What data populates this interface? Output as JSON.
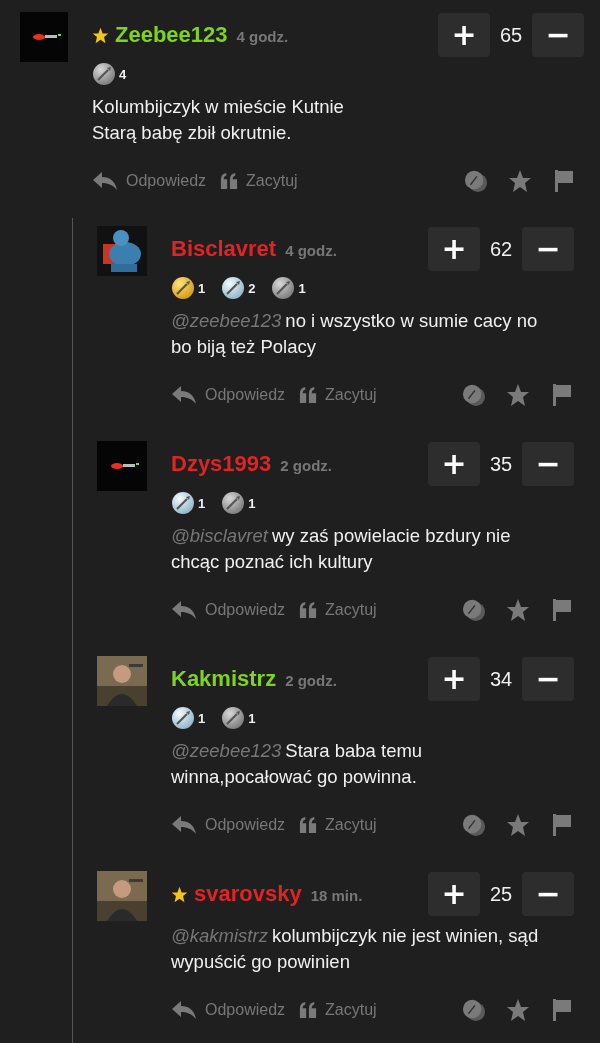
{
  "comment": {
    "author": "Zeebee123",
    "color": "#7ed321",
    "starred": true,
    "time": "4 godz.",
    "score": "65",
    "plus": "+",
    "minus": "−",
    "badges": [
      {
        "kind": "stone",
        "count": "4"
      }
    ],
    "lines": [
      "Kolumbijczyk w mieście Kutnie",
      "Starą babę zbił okrutnie."
    ],
    "reply": "Odpowiedz",
    "quote": "Zacytuj"
  },
  "replies": [
    {
      "author": "Bisclavret",
      "color": "#e02424",
      "starred": false,
      "time": "4 godz.",
      "score": "62",
      "plus": "+",
      "minus": "−",
      "badges": [
        {
          "kind": "gold",
          "count": "1"
        },
        {
          "kind": "silver",
          "count": "2"
        },
        {
          "kind": "stone",
          "count": "1"
        }
      ],
      "mention": "@zeebee123",
      "lines": [
        "no i wszystko w sumie cacy no",
        "bo biją też Polacy"
      ],
      "reply": "Odpowiedz",
      "quote": "Zacytuj"
    },
    {
      "author": "Dzys1993",
      "color": "#e02424",
      "starred": false,
      "time": "2 godz.",
      "score": "35",
      "plus": "+",
      "minus": "−",
      "badges": [
        {
          "kind": "silver",
          "count": "1"
        },
        {
          "kind": "stone",
          "count": "1"
        }
      ],
      "mention": "@bisclavret",
      "lines": [
        "wy zaś powielacie bzdury nie",
        "chcąc poznać ich kultury"
      ],
      "reply": "Odpowiedz",
      "quote": "Zacytuj"
    },
    {
      "author": "Kakmistrz",
      "color": "#7ed321",
      "starred": false,
      "time": "2 godz.",
      "score": "34",
      "plus": "+",
      "minus": "−",
      "badges": [
        {
          "kind": "silver",
          "count": "1"
        },
        {
          "kind": "stone",
          "count": "1"
        }
      ],
      "mention": "@zeebee123",
      "lines": [
        "Stara baba temu",
        "winna,pocałować go powinna."
      ],
      "reply": "Odpowiedz",
      "quote": "Zacytuj"
    },
    {
      "author": "svarovsky",
      "color": "#e02424",
      "starred": true,
      "time": "18 min.",
      "score": "25",
      "plus": "+",
      "minus": "−",
      "mention": "@kakmistrz",
      "lines": [
        "kolumbijczyk nie jest winien, sąd",
        "wypuścić go powinien"
      ],
      "reply": "Odpowiedz",
      "quote": "Zacytuj"
    }
  ]
}
